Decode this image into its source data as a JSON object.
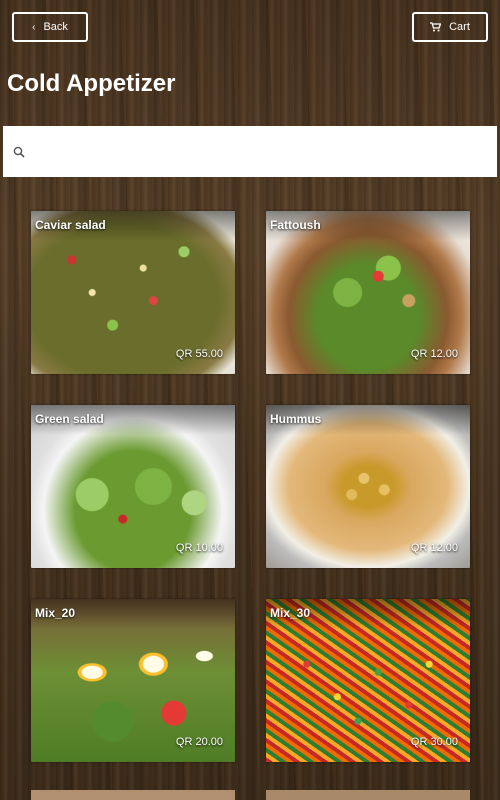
{
  "toolbar": {
    "back_label": "Back",
    "cart_label": "Cart"
  },
  "page": {
    "title": "Cold Appetizer"
  },
  "search": {
    "placeholder": "",
    "value": ""
  },
  "items": [
    {
      "name": "Caviar salad",
      "price": "QR 55.00"
    },
    {
      "name": "Fattoush",
      "price": "QR 12.00"
    },
    {
      "name": "Green salad",
      "price": "QR 10.00"
    },
    {
      "name": "Hummus",
      "price": "QR 12.00"
    },
    {
      "name": "Mix_20",
      "price": "QR 20.00"
    },
    {
      "name": "Mix_30",
      "price": "QR 30.00"
    }
  ],
  "icons": {
    "back": "chevron-left-icon",
    "cart": "cart-icon",
    "search": "search-icon"
  },
  "colors": {
    "accent": "#ffffff",
    "wood": "#4b3722"
  }
}
